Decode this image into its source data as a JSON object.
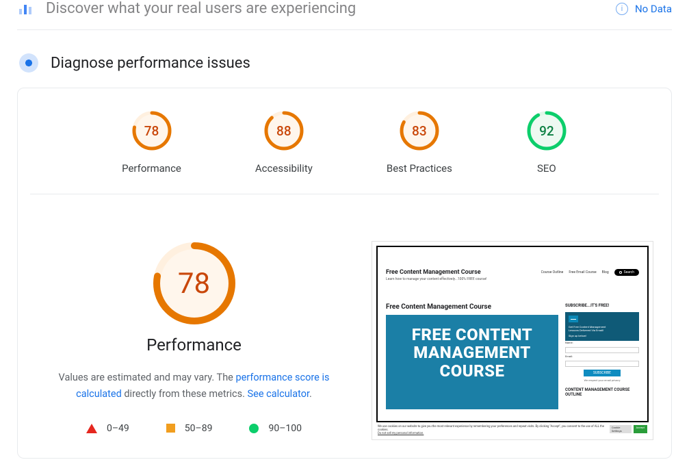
{
  "topbar": {
    "title": "Discover what your real users are experiencing",
    "no_data": "No Data"
  },
  "section": {
    "title": "Diagnose performance issues"
  },
  "gauges": {
    "performance": {
      "label": "Performance",
      "score": 78
    },
    "accessibility": {
      "label": "Accessibility",
      "score": 88
    },
    "best_practices": {
      "label": "Best Practices",
      "score": 83
    },
    "seo": {
      "label": "SEO",
      "score": 92
    }
  },
  "perf_panel": {
    "score": 78,
    "title": "Performance",
    "desc_prefix": "Values are estimated and may vary. The ",
    "link1": "performance score is calculated",
    "desc_mid": " directly from these metrics. ",
    "link2": "See calculator",
    "desc_suffix": "."
  },
  "legend": {
    "red": "0–49",
    "orange": "50–89",
    "green": "90–100"
  },
  "screenshot": {
    "header_title": "Free Content Management Course",
    "header_sub": "Learn how to manage your content effectively...100% FREE course!",
    "nav1": "Course Outline",
    "nav2": "Free Email Course",
    "nav3": "Blog",
    "nav_search": "Search",
    "main_heading": "Free Content Management Course",
    "hero_l1": "FREE CONTENT",
    "hero_l2": "MANAGEMENT",
    "hero_l3": "COURSE",
    "side_title": "SUBSCRIBE...IT'S FREE!",
    "side_box_l1": "Get Free Content Management",
    "side_box_l2": "Lessons Delivered Via Email!",
    "side_box_l3": "Sign up below!",
    "field_name": "Name:",
    "field_email": "Email:",
    "subscribe": "SUBSCRIBE",
    "respect": "We respect your email privacy",
    "outline": "CONTENT MANAGEMENT COURSE OUTLINE",
    "cookie": "We use cookies on our website to give you the most relevant experience by remembering your preferences and repeat visits. By clicking \"Accept\", you consent to the use of ALL the cookies.",
    "cookie2": "Do not sell my personal information.",
    "cookie_btn1": "Cookie Settings",
    "cookie_btn2": "Accept"
  },
  "chart_data": [
    {
      "type": "pie",
      "title": "Performance",
      "values": [
        78,
        22
      ],
      "colors": [
        "#e67700",
        "#fff0df"
      ]
    },
    {
      "type": "pie",
      "title": "Accessibility",
      "values": [
        88,
        12
      ],
      "colors": [
        "#e67700",
        "#fff0df"
      ]
    },
    {
      "type": "pie",
      "title": "Best Practices",
      "values": [
        83,
        17
      ],
      "colors": [
        "#e67700",
        "#fff0df"
      ]
    },
    {
      "type": "pie",
      "title": "SEO",
      "values": [
        92,
        8
      ],
      "colors": [
        "#0cce6b",
        "#e0f7e9"
      ]
    },
    {
      "type": "pie",
      "title": "Performance (large)",
      "values": [
        78,
        22
      ],
      "colors": [
        "#e67700",
        "#fff0df"
      ]
    }
  ]
}
